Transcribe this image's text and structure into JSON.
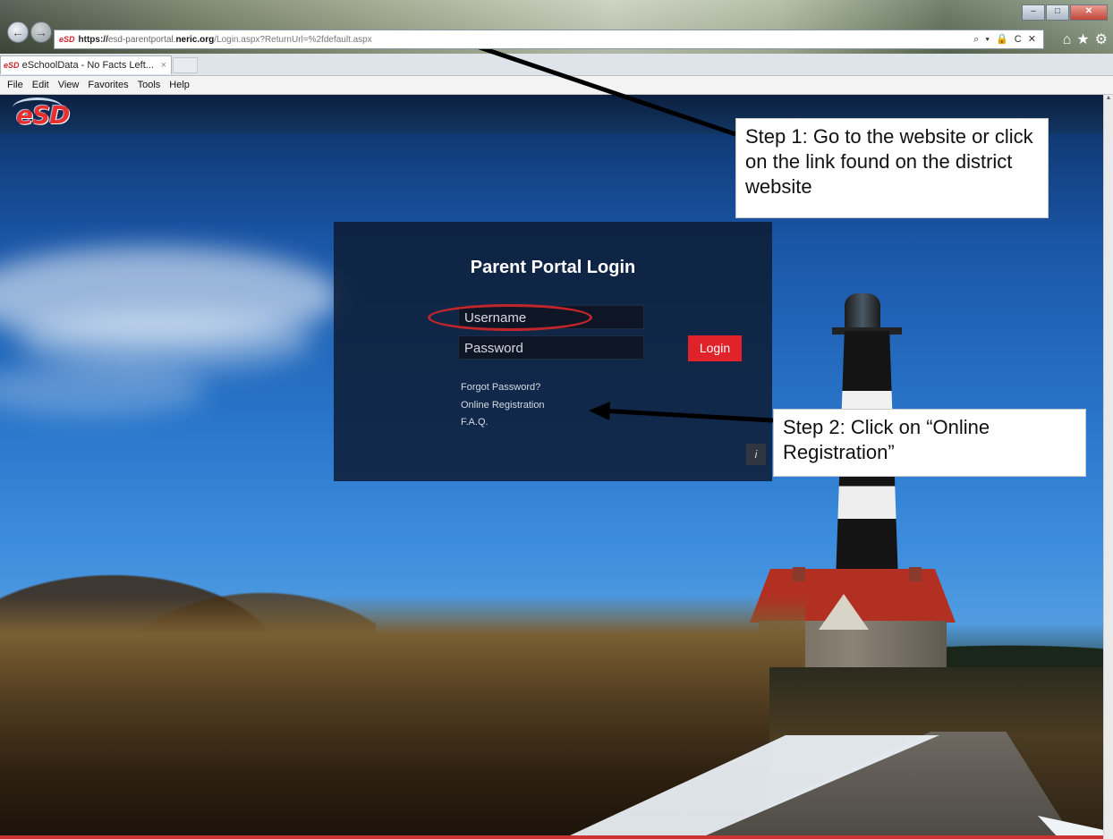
{
  "browser": {
    "url": {
      "favicon_text": "eSD",
      "protocol": "https://",
      "domain_prefix": "esd-parentportal.",
      "domain_bold": "neric.org",
      "path": "/Login.aspx?ReturnUrl=%2fdefault.aspx"
    },
    "address_icons": "⌕ ▾ 🔒 C ✕",
    "tab": {
      "favicon_text": "eSD",
      "title": "eSchoolData - No Facts Left...",
      "close": "×"
    },
    "menu": [
      "File",
      "Edit",
      "View",
      "Favorites",
      "Tools",
      "Help"
    ],
    "window_controls": {
      "minimize": "–",
      "maximize": "□",
      "close": "✕"
    },
    "toolbar_icons": {
      "home": "⌂",
      "favorites": "★",
      "settings": "⚙"
    },
    "nav": {
      "back": "←",
      "forward": "→"
    }
  },
  "page": {
    "logo_text": "eSD",
    "login": {
      "title": "Parent Portal Login",
      "username_placeholder": "Username",
      "password_placeholder": "Password",
      "login_button": "Login",
      "forgot_password": "Forgot Password?",
      "online_registration": "Online Registration",
      "faq": "F.A.Q.",
      "info": "i"
    }
  },
  "annotations": {
    "step1": "Step 1: Go to the website or click on the link found on the district website",
    "step2": "Step 2: Click on “Online Registration”",
    "highlight_color": "#c3262a",
    "arrow_color": "#000000"
  }
}
